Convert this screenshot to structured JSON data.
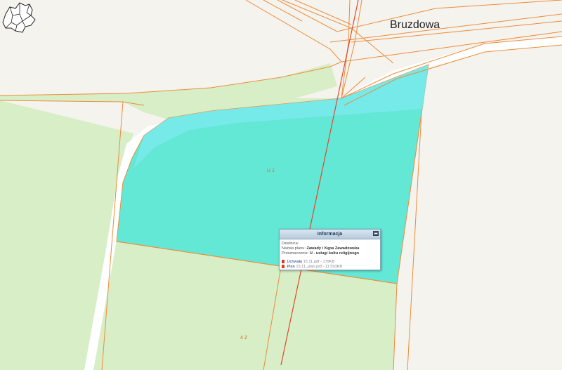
{
  "map": {
    "street_label": "Bruzdowa",
    "plot_codes": [
      "U 1",
      "4 Z"
    ],
    "colors": {
      "background": "#f4f3ee",
      "green_area": "#d7eec6",
      "highlight_area": "#63e8d6",
      "parcel_lines": "#ee8c3a",
      "road": "#ffffff"
    }
  },
  "popup": {
    "title": "Informacja",
    "district_label": "Dzielnica:",
    "district_value": "",
    "plan_label": "Nazwa planu:",
    "plan_value": "Zawady i Kępa Zawadowska",
    "purpose_label": "Przeznaczenie:",
    "purpose_value": "U - usługi kultu religijnego",
    "resolution_link": "Uchwała",
    "resolution_file": "15.11.pdf - 179KB",
    "plan_link": "Plan",
    "plan_file": "15.11_plan.pdf - 11.593KB"
  },
  "icons": {
    "popup_close": "minimize-icon",
    "pdf": "pdf-icon",
    "district_map": "district-map-icon"
  }
}
